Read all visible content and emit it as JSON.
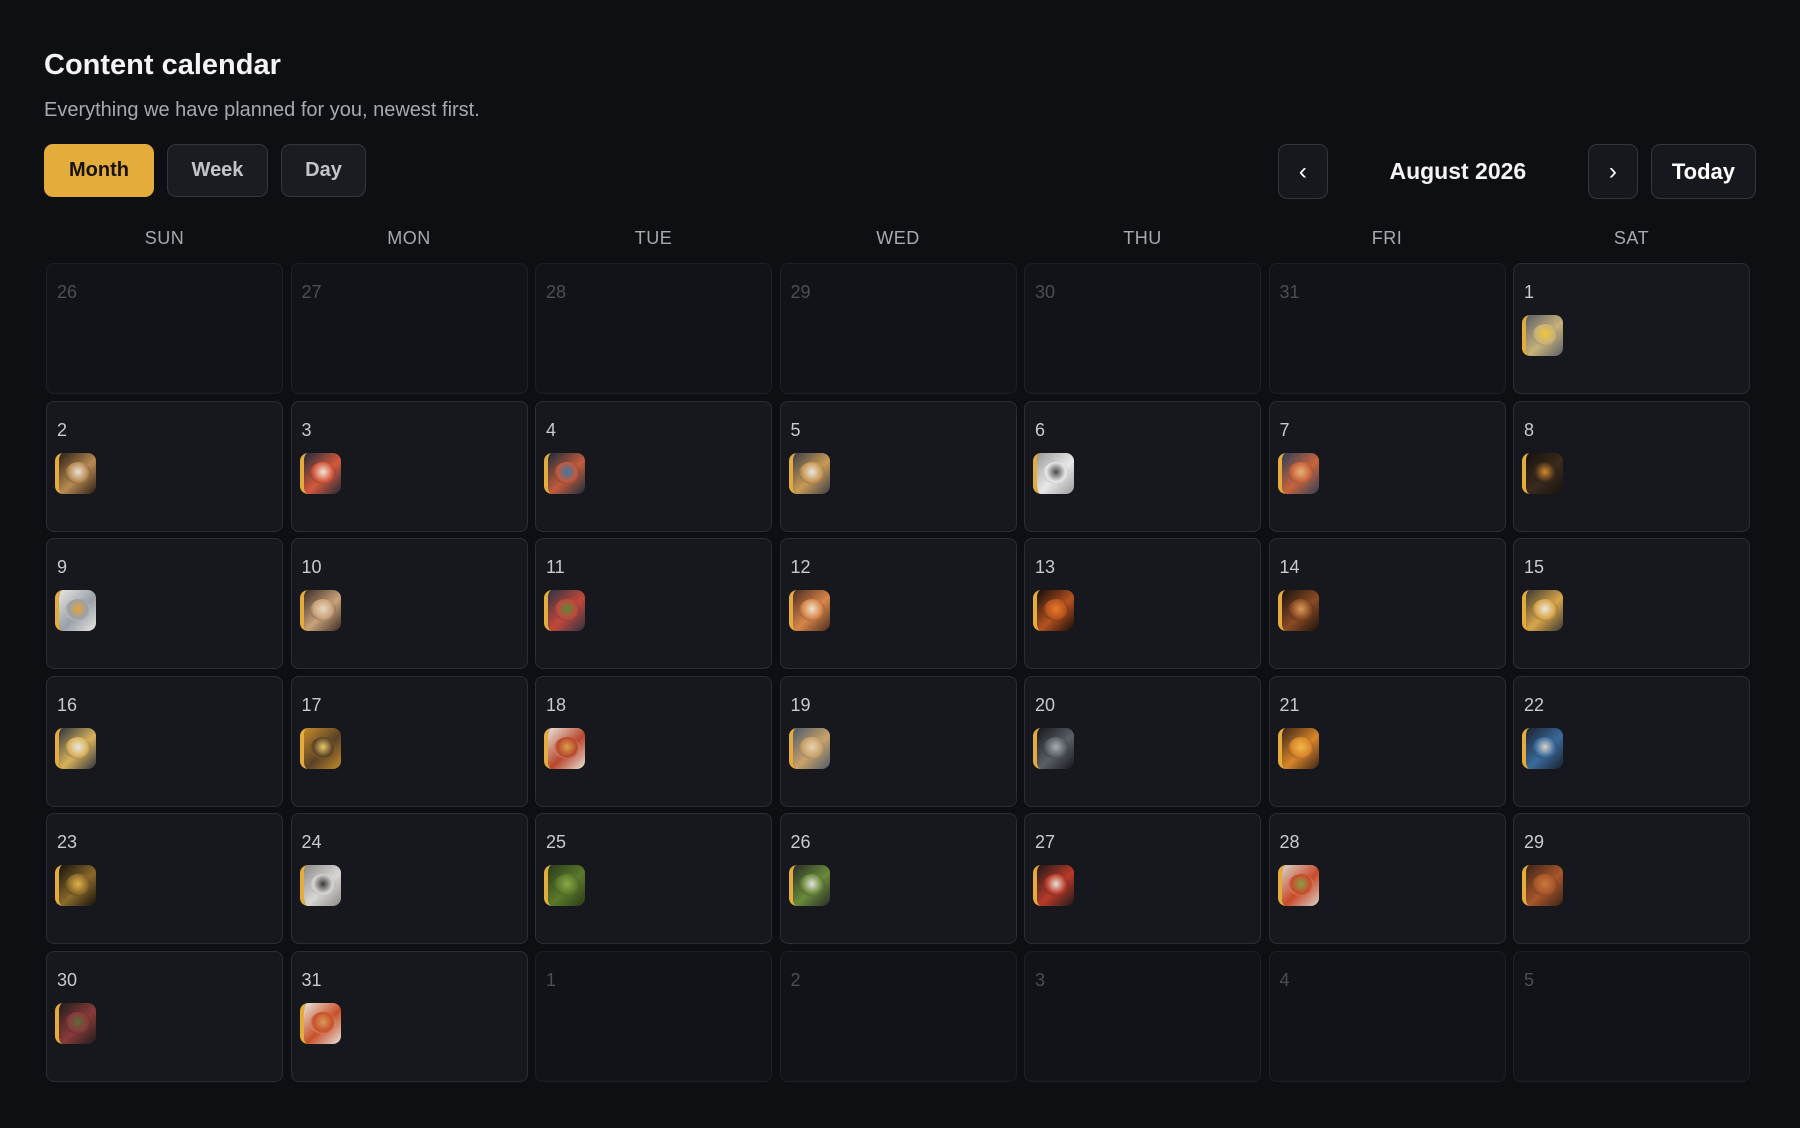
{
  "header": {
    "title": "Content calendar",
    "subtitle": "Everything we have planned for you, newest first."
  },
  "views": [
    {
      "label": "Month",
      "active": true
    },
    {
      "label": "Week",
      "active": false
    },
    {
      "label": "Day",
      "active": false
    }
  ],
  "navigation": {
    "prev_label": "‹",
    "next_label": "›",
    "month_label": "August 2026",
    "today_label": "Today"
  },
  "weekdays": [
    "SUN",
    "MON",
    "TUE",
    "WED",
    "THU",
    "FRI",
    "SAT"
  ],
  "colors": {
    "accent": "#e3ac3b",
    "background": "#0e0f13",
    "cell": "#17181d"
  },
  "days": [
    {
      "day": "26",
      "outside": true
    },
    {
      "day": "27",
      "outside": true
    },
    {
      "day": "28",
      "outside": true
    },
    {
      "day": "29",
      "outside": true
    },
    {
      "day": "30",
      "outside": true
    },
    {
      "day": "31",
      "outside": true
    },
    {
      "day": "1",
      "post": {
        "icon": "food-photo-thumbnail",
        "colors": [
          "#5a5f66",
          "#c8b27a",
          "#f0c43a"
        ]
      }
    },
    {
      "day": "2",
      "post": {
        "icon": "food-photo-thumbnail",
        "colors": [
          "#2a1e16",
          "#b88a52",
          "#e8e2d6"
        ]
      }
    },
    {
      "day": "3",
      "post": {
        "icon": "food-photo-thumbnail",
        "colors": [
          "#1d2a3a",
          "#d6583a",
          "#f2e6d8"
        ]
      }
    },
    {
      "day": "4",
      "post": {
        "icon": "food-photo-thumbnail",
        "colors": [
          "#1a2d3d",
          "#c45a3c",
          "#3a78a8"
        ]
      }
    },
    {
      "day": "5",
      "post": {
        "icon": "food-photo-thumbnail",
        "colors": [
          "#3a3e48",
          "#c99a55",
          "#e9e5df"
        ]
      }
    },
    {
      "day": "6",
      "post": {
        "icon": "food-photo-thumbnail",
        "colors": [
          "#9a9a9a",
          "#e8e8e8",
          "#4a4a4a"
        ]
      }
    },
    {
      "day": "7",
      "post": {
        "icon": "food-photo-thumbnail",
        "colors": [
          "#2d3e5a",
          "#c9643a",
          "#e6b17a"
        ]
      }
    },
    {
      "day": "8",
      "post": {
        "icon": "food-photo-thumbnail",
        "colors": [
          "#16120e",
          "#3a2a1c",
          "#d38a2a"
        ]
      }
    },
    {
      "day": "9",
      "post": {
        "icon": "food-photo-thumbnail",
        "colors": [
          "#e8e6e2",
          "#9aa0a8",
          "#e3a53a"
        ]
      }
    },
    {
      "day": "10",
      "post": {
        "icon": "food-photo-thumbnail",
        "colors": [
          "#3a2a24",
          "#c9a27a",
          "#e8d8c2"
        ]
      }
    },
    {
      "day": "11",
      "post": {
        "icon": "food-photo-thumbnail",
        "colors": [
          "#2a3344",
          "#c2473a",
          "#5a8a3a"
        ]
      }
    },
    {
      "day": "12",
      "post": {
        "icon": "food-photo-thumbnail",
        "colors": [
          "#4a2c20",
          "#d8864a",
          "#f0e2cc"
        ]
      }
    },
    {
      "day": "13",
      "post": {
        "icon": "food-photo-thumbnail",
        "colors": [
          "#120d0a",
          "#b5521f",
          "#e87a2a"
        ]
      }
    },
    {
      "day": "14",
      "post": {
        "icon": "food-photo-thumbnail",
        "colors": [
          "#1a120c",
          "#8a4a24",
          "#d89a5a"
        ]
      }
    },
    {
      "day": "15",
      "post": {
        "icon": "food-photo-thumbnail",
        "colors": [
          "#3a3832",
          "#d8a54a",
          "#ece8dc"
        ]
      }
    },
    {
      "day": "16",
      "post": {
        "icon": "food-photo-thumbnail",
        "colors": [
          "#2b3440",
          "#d8b25a",
          "#eae6dc"
        ]
      }
    },
    {
      "day": "17",
      "post": {
        "icon": "food-photo-thumbnail",
        "colors": [
          "#c58a2a",
          "#5a4226",
          "#e8c86a"
        ]
      }
    },
    {
      "day": "18",
      "post": {
        "icon": "food-photo-thumbnail",
        "colors": [
          "#e9e3d8",
          "#b8462c",
          "#d8a04a"
        ]
      }
    },
    {
      "day": "19",
      "post": {
        "icon": "food-photo-thumbnail",
        "colors": [
          "#4a5a6a",
          "#caa26a",
          "#e6d2b0"
        ]
      }
    },
    {
      "day": "20",
      "post": {
        "icon": "food-photo-thumbnail",
        "colors": [
          "#16181c",
          "#5a5e66",
          "#a8acb2"
        ]
      }
    },
    {
      "day": "21",
      "post": {
        "icon": "food-photo-thumbnail",
        "colors": [
          "#3a2418",
          "#d8862a",
          "#f0b84a"
        ]
      }
    },
    {
      "day": "22",
      "post": {
        "icon": "food-photo-thumbnail",
        "colors": [
          "#1a2230",
          "#3a6a9a",
          "#d8d4cc"
        ]
      }
    },
    {
      "day": "23",
      "post": {
        "icon": "food-photo-thumbnail",
        "colors": [
          "#14120e",
          "#8a6a2a",
          "#e0b04a"
        ]
      }
    },
    {
      "day": "24",
      "post": {
        "icon": "food-photo-thumbnail",
        "colors": [
          "#8a8a88",
          "#d8d6d2",
          "#3a3a38"
        ]
      }
    },
    {
      "day": "25",
      "post": {
        "icon": "food-photo-thumbnail",
        "colors": [
          "#2a3a1a",
          "#5a7a2a",
          "#8aa84a"
        ]
      }
    },
    {
      "day": "26",
      "post": {
        "icon": "food-photo-thumbnail",
        "colors": [
          "#2a2c28",
          "#6a8a3a",
          "#e6e2da"
        ]
      }
    },
    {
      "day": "27",
      "post": {
        "icon": "food-photo-thumbnail",
        "colors": [
          "#1e1a18",
          "#b83a2a",
          "#e8e2d6"
        ]
      }
    },
    {
      "day": "28",
      "post": {
        "icon": "food-photo-thumbnail",
        "colors": [
          "#d8d2c8",
          "#c84a2a",
          "#8aa04a"
        ]
      }
    },
    {
      "day": "29",
      "post": {
        "icon": "food-photo-thumbnail",
        "colors": [
          "#3a2418",
          "#a8562a",
          "#c8783a"
        ]
      }
    },
    {
      "day": "30",
      "post": {
        "icon": "food-photo-thumbnail",
        "colors": [
          "#1e1e1c",
          "#8a3a3a",
          "#5a6a3a"
        ]
      }
    },
    {
      "day": "31",
      "post": {
        "icon": "food-photo-thumbnail",
        "colors": [
          "#e8e4dc",
          "#c8502a",
          "#d89a5a"
        ]
      }
    },
    {
      "day": "1",
      "outside": true
    },
    {
      "day": "2",
      "outside": true
    },
    {
      "day": "3",
      "outside": true
    },
    {
      "day": "4",
      "outside": true
    },
    {
      "day": "5",
      "outside": true
    }
  ]
}
